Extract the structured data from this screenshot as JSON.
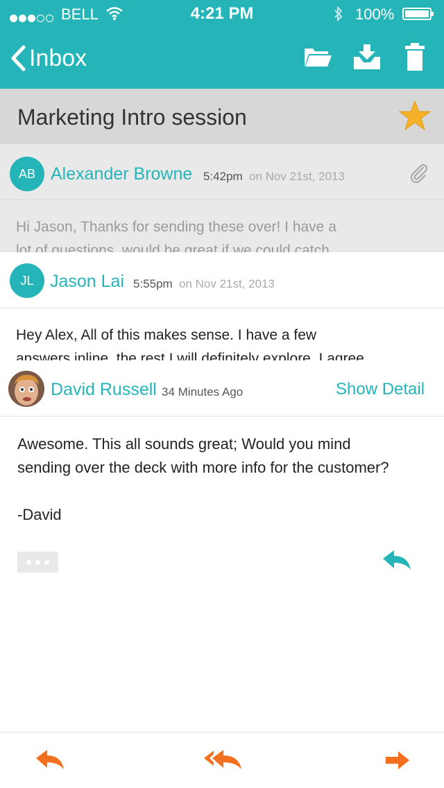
{
  "status_bar": {
    "carrier": "BELL",
    "time": "4:21 PM",
    "battery": "100%",
    "signal_bars_filled": 3,
    "signal_bars_total": 5
  },
  "nav": {
    "back_label": "Inbox",
    "icons": [
      "folder-icon",
      "archive-icon",
      "trash-icon"
    ]
  },
  "thread": {
    "subject": "Marketing Intro session",
    "starred": true
  },
  "messages": [
    {
      "initials": "AB",
      "sender": "Alexander Browne",
      "time": "5:42pm",
      "date": "on Nov 21st, 2013",
      "preview_line1": "Hi Jason, Thanks for sending these over! I have a",
      "preview_line2": "lot of questions, would be great if we could catch",
      "has_attachment": true
    },
    {
      "initials": "JL",
      "sender": "Jason Lai",
      "time": "5:55pm",
      "date": "on Nov 21st, 2013",
      "preview_line1": "Hey Alex, All of this makes sense. I have a few",
      "preview_line2": "answers inline, the rest I will definitely explore. I agree"
    },
    {
      "sender": "David Russell",
      "time_ago": "34 Minutes Ago",
      "show_detail": "Show Detail",
      "body_line1": "Awesome. This all sounds great; Would you mind",
      "body_line2": "sending over the deck with more info for the customer?",
      "signature": "-David"
    }
  ],
  "colors": {
    "accent": "#25b5b8",
    "toolbar_icons": "#f37021",
    "star": "#f5b12a"
  }
}
